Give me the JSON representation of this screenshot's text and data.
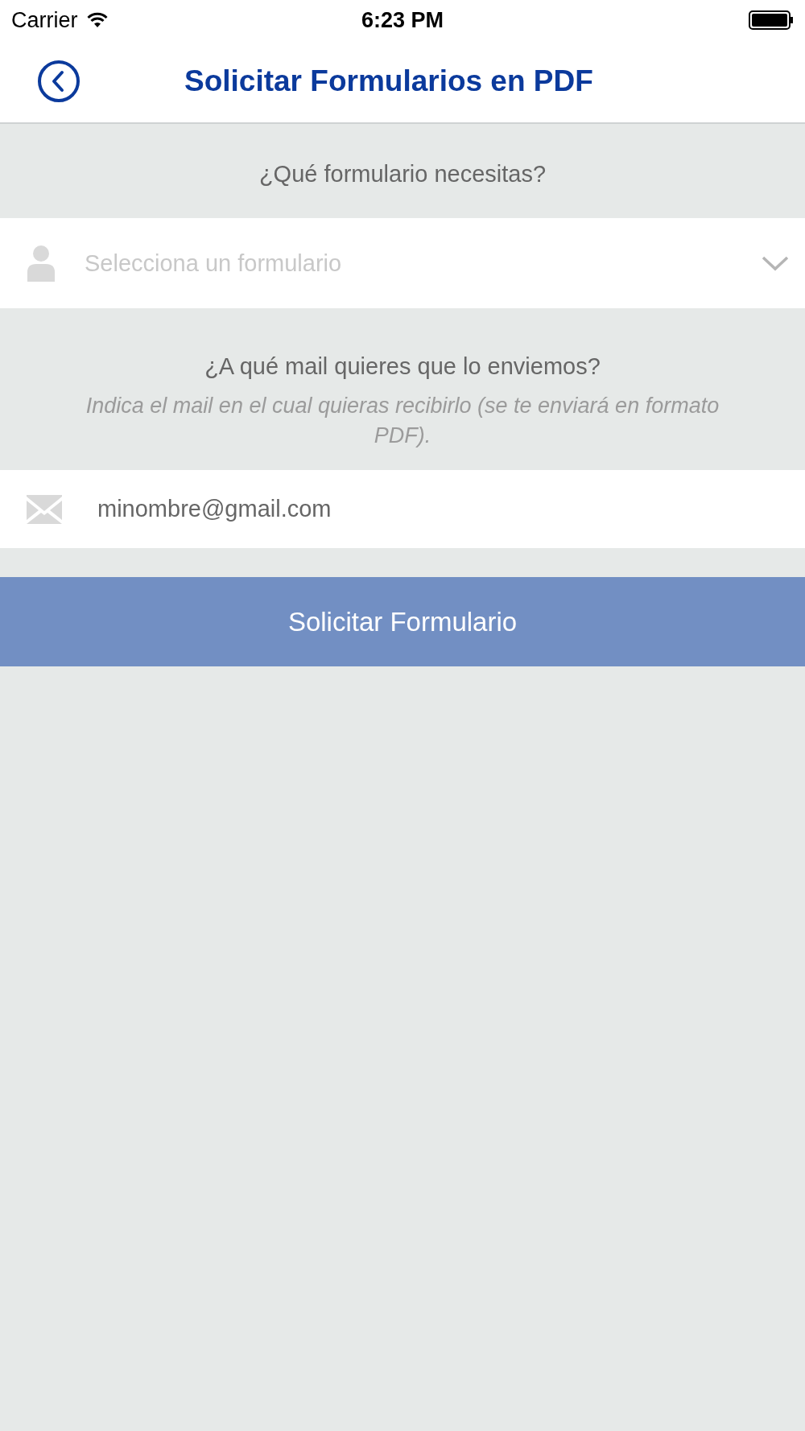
{
  "status_bar": {
    "carrier": "Carrier",
    "time": "6:23 PM"
  },
  "nav": {
    "title": "Solicitar Formularios en PDF"
  },
  "form_section": {
    "heading": "¿Qué formulario necesitas?"
  },
  "form_select": {
    "placeholder": "Selecciona un formulario"
  },
  "mail_section": {
    "heading": "¿A qué mail quieres que lo enviemos?",
    "hint": "Indica el mail en el cual quieras recibirlo (se te enviará en formato PDF)."
  },
  "mail_field": {
    "value": "minombre@gmail.com"
  },
  "submit_button": {
    "label": "Solicitar Formulario"
  }
}
